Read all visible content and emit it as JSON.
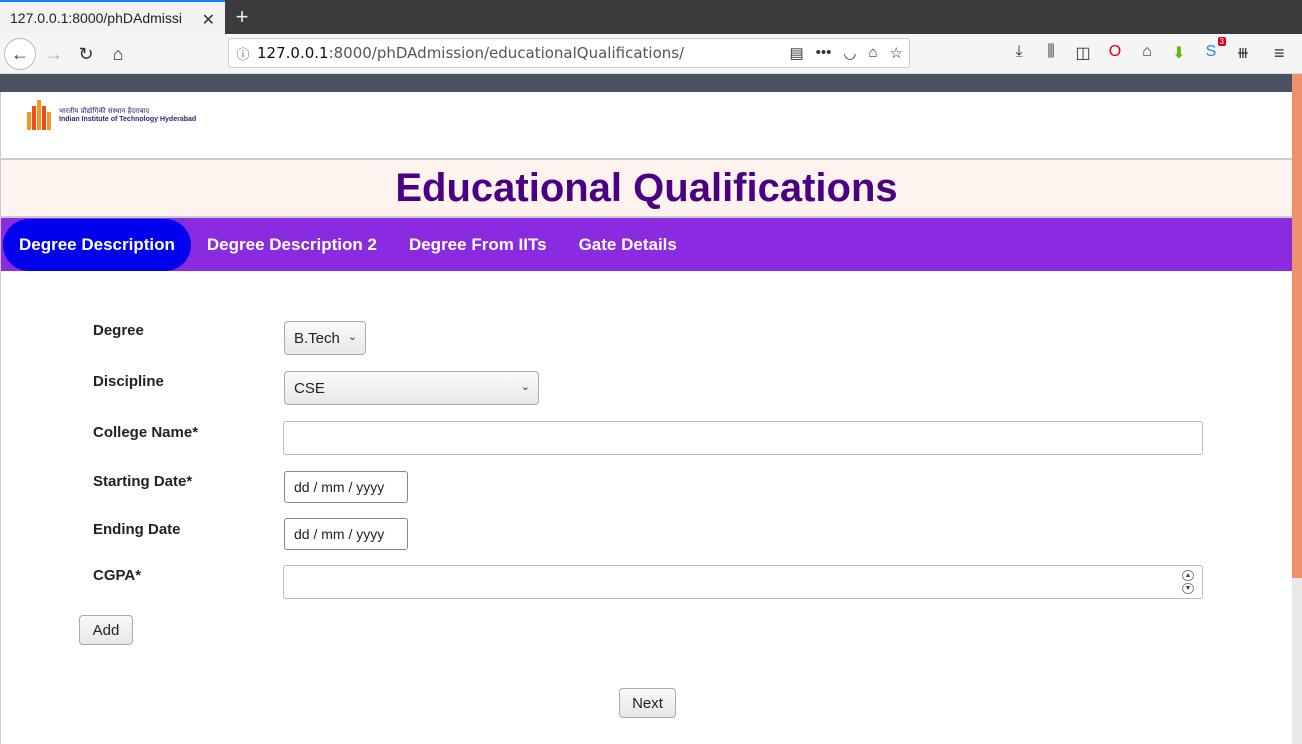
{
  "browser": {
    "tab_title": "127.0.0.1:8000/phDAdmissi",
    "tab_close": "✕",
    "new_tab": "+",
    "url_host": "127.0.0.1",
    "url_rest": ":8000/phDAdmission/educationalQualifications/",
    "notification_badge": "3"
  },
  "header": {
    "logo_hindi": "भारतीय प्रौद्योगिकी संस्थान हैदराबाद",
    "logo_english": "Indian Institute of Technology Hyderabad",
    "title": "Educational Qualifications"
  },
  "tabs": [
    {
      "label": "Degree Description",
      "active": true
    },
    {
      "label": "Degree Description 2",
      "active": false
    },
    {
      "label": "Degree From IITs",
      "active": false
    },
    {
      "label": "Gate Details",
      "active": false
    }
  ],
  "form": {
    "degree_label": "Degree",
    "degree_value": "B.Tech",
    "discipline_label": "Discipline",
    "discipline_value": "CSE",
    "college_label": "College Name*",
    "college_value": "",
    "start_label": "Starting Date*",
    "start_placeholder": "dd / mm / yyyy",
    "end_label": "Ending Date",
    "end_placeholder": "dd / mm / yyyy",
    "cgpa_label": "CGPA*",
    "cgpa_value": "",
    "add_label": "Add",
    "next_label": "Next"
  }
}
